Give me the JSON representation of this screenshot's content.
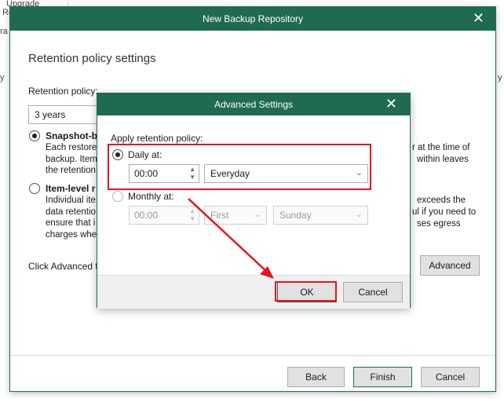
{
  "background": {
    "frag_upgrade": "Upgrade",
    "frag_re": "Re",
    "frag_ra": "ra",
    "frag_y_left": "y",
    "frag_y_right": "y"
  },
  "window": {
    "title": "New Backup Repository",
    "close": "✕",
    "section_title": "Retention policy settings",
    "retention_label": "Retention policy:",
    "retention_value": "3 years",
    "snapshot": {
      "label": "Snapshot-ba",
      "desc_lines": [
        "Each restore",
        "backup. Item",
        "the retention"
      ]
    },
    "item_level": {
      "label": "Item-level r",
      "desc_lines": [
        "Individual ite",
        "data retentio",
        "ensure that i",
        "charges whe"
      ]
    },
    "right_text": {
      "line1": "r at the time of",
      "line2": "within leaves",
      "line3": "exceeds the",
      "line4": "ul if you need to",
      "line5": "ses egress"
    },
    "click_advanced_text": "Click Advanced t",
    "advanced_button": "Advanced",
    "buttons": {
      "back": "Back",
      "finish": "Finish",
      "cancel": "Cancel"
    }
  },
  "dialog": {
    "title": "Advanced Settings",
    "close": "✕",
    "apply_label": "Apply retention policy:",
    "daily": {
      "label": "Daily at:",
      "time": "00:00",
      "frequency": "Everyday"
    },
    "monthly": {
      "label": "Monthly at:",
      "time": "00:00",
      "week": "First",
      "day": "Sunday"
    },
    "ok": "OK",
    "cancel": "Cancel"
  },
  "colors": {
    "titlebar": "#1f6b52",
    "highlight": "#e8141c"
  }
}
